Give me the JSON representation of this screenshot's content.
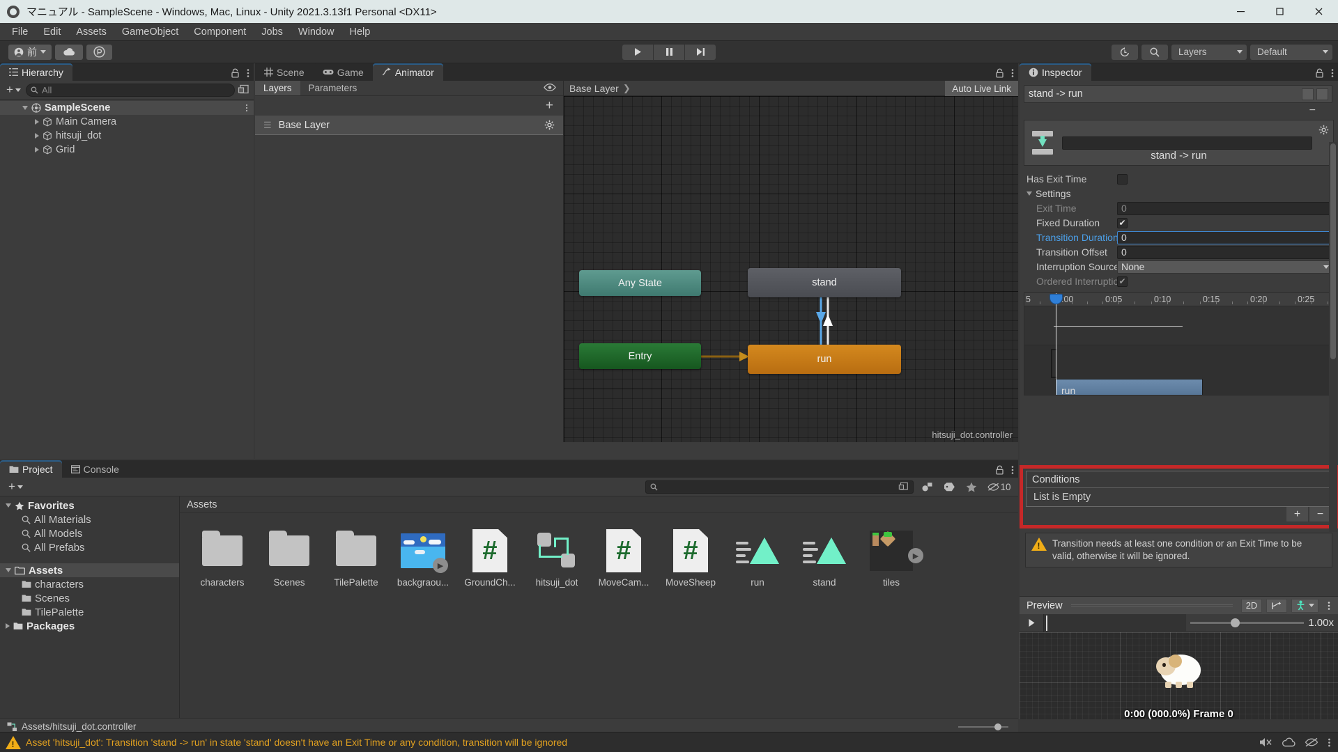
{
  "window": {
    "title": "マニュアル - SampleScene - Windows, Mac, Linux - Unity 2021.3.13f1 Personal <DX11>",
    "minimize": "—",
    "maximize": "❐",
    "close": "✕"
  },
  "menubar": {
    "items": [
      "File",
      "Edit",
      "Assets",
      "GameObject",
      "Component",
      "Jobs",
      "Window",
      "Help"
    ]
  },
  "toolbar": {
    "account_label": "前",
    "cloud_icon": "cloud-icon",
    "collab_icon": "collab-icon",
    "play_icon": "play-icon",
    "pause_icon": "pause-icon",
    "step_icon": "step-icon",
    "undo_history_icon": "undo-history-icon",
    "search_icon": "search-icon",
    "layers_label": "Layers",
    "layout_label": "Default"
  },
  "hierarchy": {
    "tab_label": "Hierarchy",
    "tab_icon": "hierarchy-icon",
    "lock_icon": "lock-icon",
    "menu_icon": "kebab-menu-icon",
    "add_label": "+",
    "search_placeholder": "All",
    "tree": [
      {
        "label": "SampleScene",
        "depth": 0,
        "icon": "scene-icon",
        "selected": true,
        "expanded": true,
        "bold": true
      },
      {
        "label": "Main Camera",
        "depth": 1,
        "icon": "gameobject-icon",
        "selected": false,
        "expanded": false,
        "bold": false
      },
      {
        "label": "hitsuji_dot",
        "depth": 1,
        "icon": "gameobject-icon",
        "selected": false,
        "expanded": false,
        "bold": false
      },
      {
        "label": "Grid",
        "depth": 1,
        "icon": "gameobject-icon",
        "selected": false,
        "expanded": false,
        "bold": false
      }
    ]
  },
  "animator": {
    "tabs": [
      {
        "label": "Scene",
        "icon": "grid-icon",
        "active": false
      },
      {
        "label": "Game",
        "icon": "gamepad-icon",
        "active": false
      },
      {
        "label": "Animator",
        "icon": "animator-icon",
        "active": true
      }
    ],
    "lock_icon": "lock-icon",
    "menu_icon": "kebab-menu-icon",
    "subtabs": [
      {
        "label": "Layers",
        "active": true
      },
      {
        "label": "Parameters",
        "active": false
      }
    ],
    "eye_icon": "eye-icon",
    "add_layer_label": "+",
    "layer_name": "Base Layer",
    "layer_gear_icon": "gear-icon",
    "breadcrumb": "Base Layer",
    "auto_live_link": "Auto Live Link",
    "controller_path_label": "hitsuji_dot.controller",
    "nodes": [
      {
        "id": "any-state",
        "label": "Any State",
        "color": "#4f8a80"
      },
      {
        "id": "entry",
        "label": "Entry",
        "color": "#1f6a29"
      },
      {
        "id": "stand",
        "label": "stand",
        "color": "#54565c"
      },
      {
        "id": "run",
        "label": "run",
        "color": "#c67c17"
      }
    ]
  },
  "project": {
    "tabs": [
      {
        "label": "Project",
        "icon": "folder-icon",
        "active": true
      },
      {
        "label": "Console",
        "icon": "console-icon",
        "active": false
      }
    ],
    "lock_icon": "lock-icon",
    "menu_icon": "kebab-menu-icon",
    "add_label": "+",
    "search_placeholder": "",
    "search_icon": "search-icon",
    "icons": [
      "object-filter-icon",
      "label-filter-icon",
      "favorite-star-icon"
    ],
    "hidden_count": "10",
    "hidden_icon": "hidden-eye-icon",
    "tree": [
      {
        "label": "Favorites",
        "depth": 0,
        "icon": "star-icon",
        "bold": true,
        "expanded": true
      },
      {
        "label": "All Materials",
        "depth": 1,
        "icon": "search-icon",
        "bold": false
      },
      {
        "label": "All Models",
        "depth": 1,
        "icon": "search-icon",
        "bold": false
      },
      {
        "label": "All Prefabs",
        "depth": 1,
        "icon": "search-icon",
        "bold": false
      },
      {
        "label": "Assets",
        "depth": 0,
        "icon": "folder-open-icon",
        "bold": true,
        "expanded": true,
        "selected": true
      },
      {
        "label": "characters",
        "depth": 1,
        "icon": "folder-icon",
        "bold": false
      },
      {
        "label": "Scenes",
        "depth": 1,
        "icon": "folder-icon",
        "bold": false
      },
      {
        "label": "TilePalette",
        "depth": 1,
        "icon": "folder-icon",
        "bold": false
      },
      {
        "label": "Packages",
        "depth": 0,
        "icon": "folder-icon",
        "bold": true,
        "expanded": false
      }
    ],
    "assets_header": "Assets",
    "assets": [
      {
        "name": "characters",
        "type": "folder"
      },
      {
        "name": "Scenes",
        "type": "folder"
      },
      {
        "name": "TilePalette",
        "type": "folder"
      },
      {
        "name": "backgraou...",
        "type": "sprite"
      },
      {
        "name": "GroundCh...",
        "type": "script"
      },
      {
        "name": "hitsuji_dot",
        "type": "controller"
      },
      {
        "name": "MoveCam...",
        "type": "script"
      },
      {
        "name": "MoveSheep",
        "type": "script"
      },
      {
        "name": "run",
        "type": "clip"
      },
      {
        "name": "stand",
        "type": "clip"
      },
      {
        "name": "tiles",
        "type": "tiles"
      }
    ],
    "footer_path": "Assets/hitsuji_dot.controller",
    "footer_icon": "controller-icon"
  },
  "inspector": {
    "tab_label": "Inspector",
    "tab_icon": "info-icon",
    "lock_icon": "lock-icon",
    "menu_icon": "kebab-menu-icon",
    "transition_name": "stand -> run",
    "preview_name": "stand -> run",
    "transition_icon": "transition-icon",
    "gear_icon": "gear-icon",
    "minus_label": "−",
    "fields": [
      {
        "label": "Has Exit Time",
        "type": "checkbox",
        "checked": false,
        "dim": false,
        "indent": 0
      },
      {
        "label": "Settings",
        "type": "foldout",
        "expanded": true,
        "dim": false,
        "indent": 0
      },
      {
        "label": "Exit Time",
        "type": "text",
        "value": "0",
        "dim": true,
        "indent": 1
      },
      {
        "label": "Fixed Duration",
        "type": "checkbox",
        "checked": true,
        "dim": false,
        "indent": 1
      },
      {
        "label": "Transition Duration",
        "type": "text",
        "value": "0",
        "dim": false,
        "focused": true,
        "highlight": "blue",
        "indent": 1
      },
      {
        "label": "Transition Offset",
        "type": "text",
        "value": "0",
        "dim": false,
        "indent": 1
      },
      {
        "label": "Interruption Source",
        "type": "dropdown",
        "value": "None",
        "dim": false,
        "indent": 1
      },
      {
        "label": "Ordered Interruption",
        "type": "checkbox",
        "checked": true,
        "dim": true,
        "indent": 1
      }
    ],
    "timeline": {
      "ticks": [
        "5",
        ":00",
        "0:05",
        "0:10",
        "0:15",
        "0:20",
        "0:25"
      ],
      "clip_label": "run",
      "playhead_label": "playhead-knob"
    },
    "conditions": {
      "header": "Conditions",
      "empty_text": "List is Empty",
      "add_label": "+",
      "remove_label": "−",
      "highlight_color": "#c62828"
    },
    "warning": {
      "icon": "warning-icon",
      "text": "Transition needs at least one condition or an Exit Time to be valid, otherwise it will be ignored."
    },
    "preview": {
      "title": "Preview",
      "btn_2d": "2D",
      "btn_pivot_icon": "pivot-icon",
      "btn_avatar_icon": "avatar-icon",
      "menu_icon": "kebab-menu-icon",
      "play_icon": "play-icon",
      "speed_value": "1.00x",
      "time_label": "0:00 (000.0%) Frame 0",
      "tag_icon": "tag-icon"
    }
  },
  "statusbar": {
    "warning_icon": "warning-icon",
    "message": "Asset 'hitsuji_dot': Transition 'stand -> run' in state 'stand' doesn't have an Exit Time or any condition, transition will be ignored",
    "right_icons": [
      "mute-audio-icon",
      "cloud-status-icon",
      "hidden-eye-icon",
      "kebab-menu-icon"
    ]
  }
}
